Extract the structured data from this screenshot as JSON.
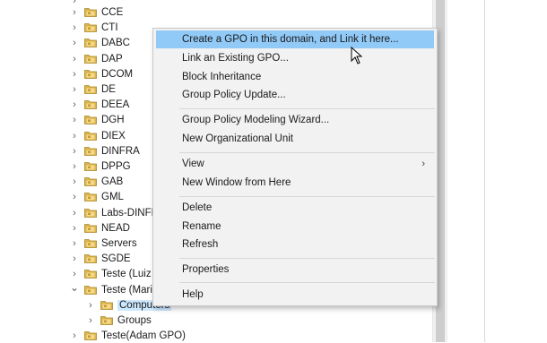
{
  "tree": {
    "items": [
      {
        "label": "CCE",
        "expanded": false
      },
      {
        "label": "CTI",
        "expanded": false
      },
      {
        "label": "DABC",
        "expanded": false
      },
      {
        "label": "DAP",
        "expanded": false
      },
      {
        "label": "DCOM",
        "expanded": false
      },
      {
        "label": "DE",
        "expanded": false
      },
      {
        "label": "DEEA",
        "expanded": false
      },
      {
        "label": "DGH",
        "expanded": false
      },
      {
        "label": "DIEX",
        "expanded": false
      },
      {
        "label": "DINFRA",
        "expanded": false
      },
      {
        "label": "DPPG",
        "expanded": false
      },
      {
        "label": "GAB",
        "expanded": false
      },
      {
        "label": "GML",
        "expanded": false
      },
      {
        "label": "Labs-DINFR",
        "expanded": false
      },
      {
        "label": "NEAD",
        "expanded": false
      },
      {
        "label": "Servers",
        "expanded": false
      },
      {
        "label": "SGDE",
        "expanded": false
      },
      {
        "label": "Teste (Luiz (",
        "expanded": false
      },
      {
        "label": "Teste (Mari",
        "expanded": true
      },
      {
        "label": "Computers",
        "expanded": false,
        "child": true,
        "selected": true
      },
      {
        "label": "Groups",
        "expanded": false,
        "child": true
      },
      {
        "label": "Teste(Adam GPO)",
        "expanded": false
      }
    ]
  },
  "context_menu": {
    "items": [
      {
        "label": "Create a GPO in this domain, and Link it here...",
        "hover": true
      },
      {
        "label": "Link an Existing GPO..."
      },
      {
        "label": "Block Inheritance"
      },
      {
        "label": "Group Policy Update..."
      },
      {
        "label": "Group Policy Modeling Wizard..."
      },
      {
        "label": "New Organizational Unit"
      },
      {
        "label": "View",
        "submenu": true
      },
      {
        "label": "New Window from Here"
      },
      {
        "label": "Delete"
      },
      {
        "label": "Rename"
      },
      {
        "label": "Refresh"
      },
      {
        "label": "Properties"
      },
      {
        "label": "Help"
      }
    ],
    "submenu_arrow": "›"
  },
  "icons": {
    "expand": "chevron-right-icon",
    "collapse": "chevron-down-icon",
    "folder": "folder-icon",
    "cursor": "mouse-pointer-icon"
  },
  "colors": {
    "hover": "#91c9f7",
    "menu_bg": "#f2f2f2",
    "folder": "#dcb54a",
    "selected": "#cce8ff"
  }
}
